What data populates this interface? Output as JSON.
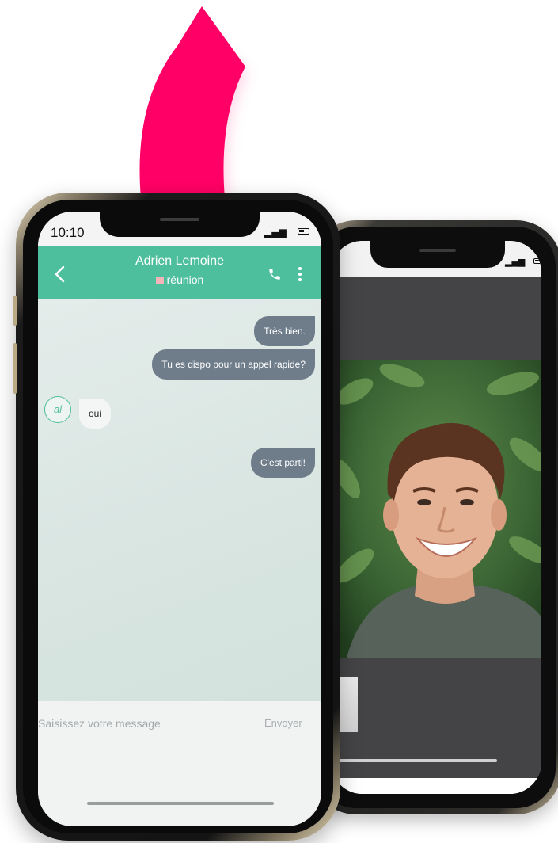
{
  "colors": {
    "accent": "#4dbf9c",
    "sent_bubble": "#6f7d8b",
    "arrow_pink": "#ff0066",
    "arrow_orange": "#ff4a2e",
    "video_background": "#444447"
  },
  "front_phone": {
    "status_bar": {
      "time": "10:10",
      "signal_icon": "signal-bars-icon",
      "battery_icon": "battery-icon"
    },
    "header": {
      "back_icon": "chevron-left-icon",
      "contact_name": "Adrien Lemoine",
      "contact_status": "réunion",
      "call_icon": "phone-icon",
      "menu_icon": "more-vertical-icon"
    },
    "messages": [
      {
        "direction": "sent",
        "text": "Très bien."
      },
      {
        "direction": "sent",
        "text": "Tu es dispo pour un appel rapide?"
      },
      {
        "direction": "received",
        "text": "oui",
        "avatar_initials": "al"
      },
      {
        "direction": "sent",
        "text": "C'est parti!"
      }
    ],
    "composer": {
      "placeholder": "Saisissez votre message",
      "value": "",
      "send_label": "Envoyer"
    }
  },
  "back_phone": {
    "screen": "video-call",
    "remote_video": "smiling-man-video",
    "self_view": "self-view-thumbnail",
    "status_bar": {
      "signal_icon": "signal-bars-icon",
      "battery_icon": "battery-icon"
    }
  }
}
